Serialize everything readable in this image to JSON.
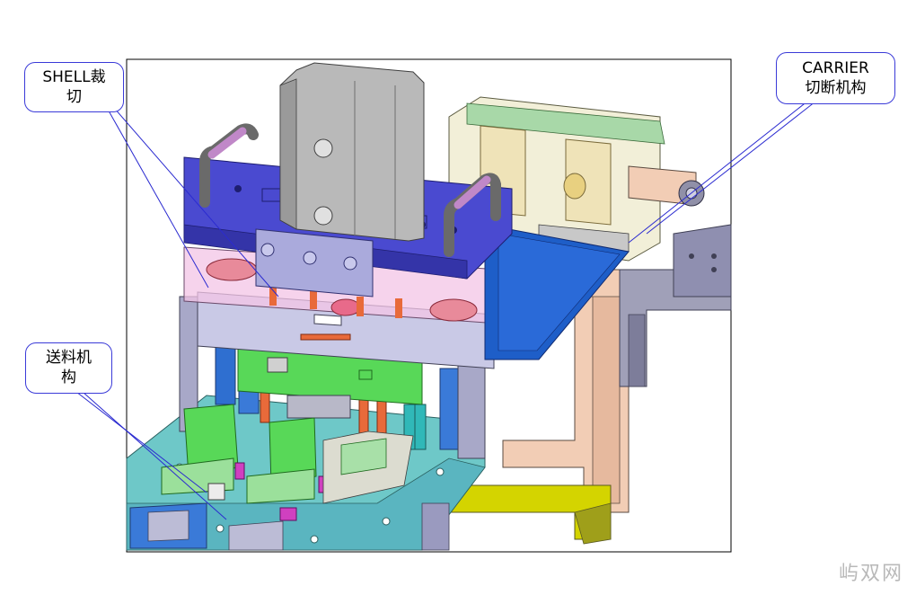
{
  "callouts": {
    "shell": {
      "line1": "SHELL裁",
      "line2": "切"
    },
    "carrier": {
      "line1": "CARRIER",
      "line2": "切断机构"
    },
    "feed": {
      "line1": "送料机",
      "line2": "构"
    }
  },
  "watermark": "屿双网",
  "colors": {
    "callout_border": "#3a3ad8",
    "leader_line": "#2b2bd0",
    "top_plate": "#4a4ad0",
    "cylinder": "#b9b9b9",
    "base_plate": "#6ec8c8",
    "feed_block": "#58d858",
    "frame": "#f2cdb5",
    "carrier_box": "#efe3b8",
    "side_bracket": "#8f8fb0"
  },
  "icons": [
    "cylinder-icon",
    "handle-icon"
  ]
}
